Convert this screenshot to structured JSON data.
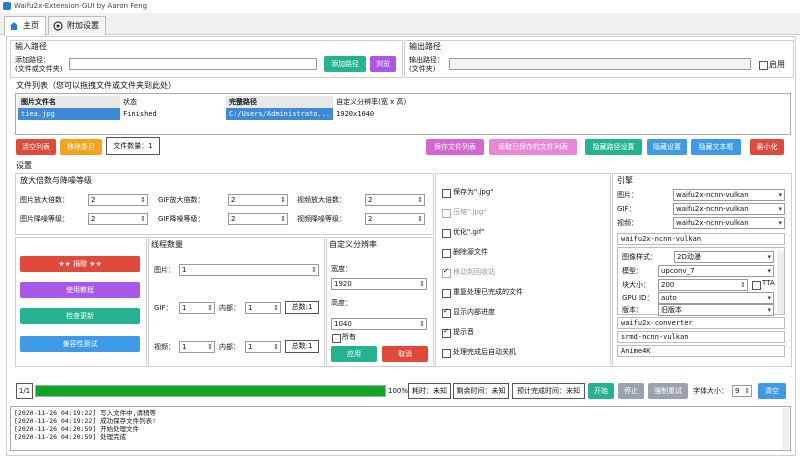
{
  "window": {
    "title": "Waifu2x-Extension-GUI by Aaron Feng"
  },
  "tabs": [
    {
      "label": "主页"
    },
    {
      "label": "附加设置"
    }
  ],
  "input_path": {
    "group_title": "输入路径",
    "label_line1": "添加路径：",
    "label_line2": "(文件或文件夹)",
    "value": "",
    "add_button": "添加路径",
    "browse_button": "浏览"
  },
  "output_path": {
    "group_title": "输出路径",
    "label_line1": "输出路径：",
    "label_line2": "(文件夹)",
    "value": "",
    "enable_label": "启用",
    "enabled": false
  },
  "file_list": {
    "title": "文件列表（您可以拖拽文件或文件夹到此处）",
    "headers": [
      "图片文件名",
      "状态",
      "完整路径",
      "自定义分辨率(宽 x 高)"
    ],
    "rows": [
      {
        "name": "tiea.jpg",
        "status": "Finished",
        "path": "C:/Users/Administrato...",
        "resolution": "1920x1040"
      }
    ]
  },
  "list_actions": {
    "clear_list": "清空列表",
    "remove_item": "移除条目",
    "file_count": "文件数量：1",
    "save_list": "保存文件列表",
    "read_list": "读取已保存的文件列表",
    "hide_path_settings": "隐藏路径设置",
    "hide_settings": "隐藏设置",
    "hide_text_box": "隐藏文本框",
    "minimize": "最小化"
  },
  "settings": {
    "title": "设置",
    "scale_group_title": "放大倍数与降噪等级",
    "image_scale_label": "图片放大倍数：",
    "image_scale": "2",
    "gif_scale_label": "GIF放大倍数：",
    "gif_scale": "2",
    "video_scale_label": "视频放大倍数：",
    "video_scale": "2",
    "image_denoise_label": "图片降噪等级：",
    "image_denoise": "2",
    "gif_denoise_label": "GIF降噪等级：",
    "gif_denoise": "2",
    "video_denoise_label": "视频降噪等级：",
    "video_denoise": "2"
  },
  "left_buttons": {
    "donate": "★★ 捐赠 ★★",
    "tutorial": "使用教程",
    "check_update": "检查更新",
    "compat_test": "兼容性测试"
  },
  "threads": {
    "title": "线程数量",
    "image_label": "图片：",
    "image_value": "1",
    "gif_label": "GIF：",
    "gif_value": "1",
    "gif_inner_label": "内部：",
    "gif_inner_value": "1",
    "gif_total": "总数:1",
    "video_label": "视频：",
    "video_value": "1",
    "video_inner_label": "内部：",
    "video_inner_value": "1",
    "video_total": "总数:1"
  },
  "custom_res": {
    "title": "自定义分辨率",
    "width_label": "宽度：",
    "width_value": "1920",
    "height_label": "高度：",
    "height_value": "1040",
    "all_label": "所有",
    "apply_button": "应用",
    "cancel_button": "取消"
  },
  "options": [
    {
      "label": "保存为\".jpg\"",
      "checked": false,
      "disabled": false
    },
    {
      "label": "压缩\".jpg\"",
      "checked": false,
      "disabled": true
    },
    {
      "label": "优化\".gif\"",
      "checked": false,
      "disabled": false
    },
    {
      "label": "删除源文件",
      "checked": false,
      "disabled": false
    },
    {
      "label": "移动到回收站",
      "checked": true,
      "disabled": true
    },
    {
      "label": "重复处理已完成的文件",
      "checked": false,
      "disabled": false
    },
    {
      "label": "显示内部进度",
      "checked": true,
      "disabled": false
    },
    {
      "label": "提示音",
      "checked": true,
      "disabled": false
    },
    {
      "label": "处理完成后自动关机",
      "checked": false,
      "disabled": false
    }
  ],
  "engine": {
    "title": "引擎",
    "image_label": "图片：",
    "image_engine": "waifu2x-ncnn-vulkan",
    "gif_label": "GIF：",
    "gif_engine": "waifu2x-ncnn-vulkan",
    "video_label": "视频：",
    "video_engine": "waifu2x-ncnn-vulkan",
    "current_engine": "waifu2x-ncnn-vulkan",
    "style_label": "图像样式：",
    "style_value": "2D动漫",
    "model_label": "模型：",
    "model_value": "upconv_7",
    "block_label": "块大小：",
    "block_value": "200",
    "tta_label": "TTA",
    "gpu_label": "GPU ID：",
    "gpu_value": "auto",
    "version_label": "版本：",
    "version_value": "旧版本",
    "engine_list": [
      "waifu2x-converter",
      "srmd-ncnn-vulkan",
      "Anime4K"
    ]
  },
  "progress": {
    "counter": "1/1",
    "percent": 100,
    "percent_text": "100%",
    "elapsed": "耗时：未知",
    "remaining": "剩余时间：未知",
    "eta": "预计完成时间：未知",
    "start_button": "开始",
    "stop_button": "停止",
    "force_retry_button": "强制重试",
    "font_size_label": "字体大小：",
    "font_size_value": "9",
    "clear_button": "清空"
  },
  "log": {
    "lines": [
      "[2020-11-26 04:19:22] 写入文件中,请稍等",
      "[2020-11-26 04:19:22] 成功保存文件列表!",
      "[2020-11-26 04:20:59] 开始处理文件",
      "[2020-11-26 04:20:59] 处理完成"
    ]
  },
  "colors": {
    "red": "#e14a3b",
    "orange": "#f4a41b",
    "purple": "#a857e8",
    "pink": "#d466d1",
    "teal": "#25b38f",
    "blue": "#3d9ae8",
    "gray": "#9aa3ad",
    "green_progress": "#11a428",
    "selected_row": "#3e8ad6"
  }
}
